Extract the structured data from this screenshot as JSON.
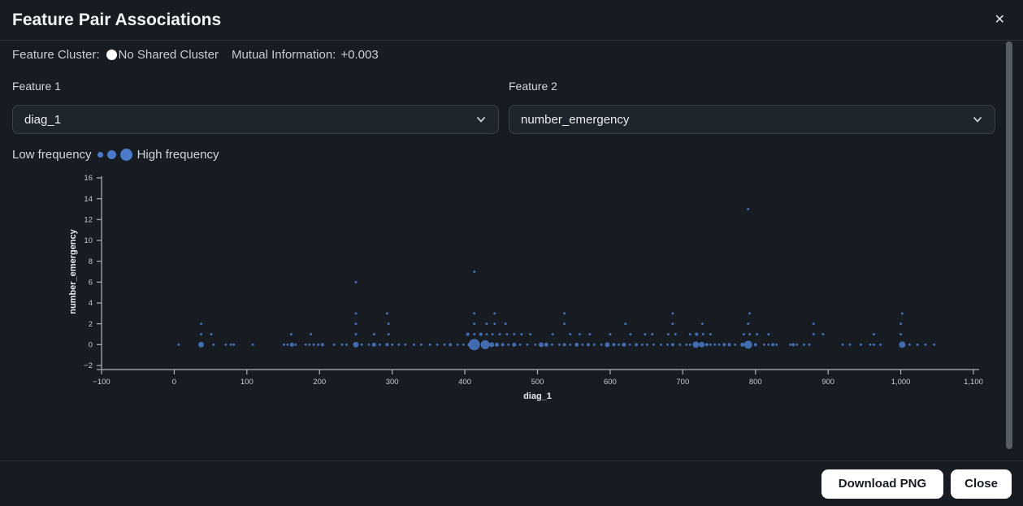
{
  "modal": {
    "title": "Feature Pair Associations",
    "close_icon": "✕"
  },
  "meta": {
    "cluster_label": "Feature Cluster:",
    "cluster_value": "No Shared Cluster",
    "cluster_color": "#ffffff",
    "mi_label": "Mutual Information:",
    "mi_value": "+0.003"
  },
  "features": {
    "feature1_label": "Feature 1",
    "feature1_value": "diag_1",
    "feature2_label": "Feature 2",
    "feature2_value": "number_emergency"
  },
  "legend": {
    "low_label": "Low frequency",
    "high_label": "High frequency",
    "dot_color": "#4a7ac8"
  },
  "footer": {
    "download_label": "Download PNG",
    "close_label": "Close"
  },
  "colors": {
    "background": "#171c22",
    "accent_blue": "#4a7ac8",
    "axis": "#aeb4bb",
    "tick_text": "#c6cbd2"
  },
  "chart_data": {
    "type": "scatter",
    "title": "",
    "xlabel": "diag_1",
    "ylabel": "number_emergency",
    "xlim": [
      -100,
      1100
    ],
    "ylim": [
      -2,
      16
    ],
    "xticks": [
      -100,
      0,
      100,
      200,
      300,
      400,
      500,
      600,
      700,
      800,
      900,
      1000,
      1100
    ],
    "yticks": [
      -2,
      0,
      2,
      4,
      6,
      8,
      10,
      12,
      14,
      16
    ],
    "grid": false,
    "legend_position": "none",
    "point_color": "#4a7ac8",
    "size_meaning": "frequency",
    "points": [
      [
        6,
        0,
        1.5
      ],
      [
        37,
        0,
        3.5
      ],
      [
        54,
        0,
        1.5
      ],
      [
        71,
        0,
        1.5
      ],
      [
        78,
        0,
        1.5
      ],
      [
        82,
        0,
        1.5
      ],
      [
        108,
        0,
        1.5
      ],
      [
        151,
        0,
        1.5
      ],
      [
        156,
        0,
        1.5
      ],
      [
        162,
        0,
        2.5
      ],
      [
        167,
        0,
        1.5
      ],
      [
        181,
        0,
        1.5
      ],
      [
        186,
        0,
        1.5
      ],
      [
        192,
        0,
        1.5
      ],
      [
        198,
        0,
        1.5
      ],
      [
        204,
        0,
        2
      ],
      [
        220,
        0,
        1.5
      ],
      [
        231,
        0,
        1.5
      ],
      [
        237,
        0,
        1.5
      ],
      [
        250,
        0,
        3.5
      ],
      [
        258,
        0,
        1.5
      ],
      [
        268,
        0,
        1.5
      ],
      [
        275,
        0,
        2.5
      ],
      [
        283,
        0,
        1.5
      ],
      [
        293,
        0,
        2
      ],
      [
        300,
        0,
        1.5
      ],
      [
        309,
        0,
        1.5
      ],
      [
        318,
        0,
        1.5
      ],
      [
        330,
        0,
        1.5
      ],
      [
        340,
        0,
        1.5
      ],
      [
        352,
        0,
        1.5
      ],
      [
        362,
        0,
        1.5
      ],
      [
        372,
        0,
        1.5
      ],
      [
        380,
        0,
        2
      ],
      [
        390,
        0,
        1.5
      ],
      [
        398,
        0,
        1.5
      ],
      [
        406,
        0,
        2
      ],
      [
        413,
        0,
        7
      ],
      [
        428,
        0,
        5.5
      ],
      [
        437,
        0,
        3
      ],
      [
        444,
        0,
        2.5
      ],
      [
        452,
        0,
        2
      ],
      [
        460,
        0,
        1.5
      ],
      [
        468,
        0,
        2.5
      ],
      [
        476,
        0,
        1.5
      ],
      [
        486,
        0,
        1.5
      ],
      [
        497,
        0,
        1.5
      ],
      [
        505,
        0,
        3
      ],
      [
        512,
        0,
        2.5
      ],
      [
        520,
        0,
        1.5
      ],
      [
        530,
        0,
        1.5
      ],
      [
        537,
        0,
        2
      ],
      [
        545,
        0,
        1.5
      ],
      [
        554,
        0,
        2.5
      ],
      [
        562,
        0,
        1.5
      ],
      [
        570,
        0,
        2
      ],
      [
        578,
        0,
        1.5
      ],
      [
        588,
        0,
        1.5
      ],
      [
        596,
        0,
        3
      ],
      [
        605,
        0,
        2
      ],
      [
        612,
        0,
        1.5
      ],
      [
        619,
        0,
        2.5
      ],
      [
        627,
        0,
        1.5
      ],
      [
        636,
        0,
        2
      ],
      [
        644,
        0,
        1.5
      ],
      [
        651,
        0,
        1.5
      ],
      [
        660,
        0,
        1.5
      ],
      [
        670,
        0,
        1.5
      ],
      [
        679,
        0,
        1.5
      ],
      [
        686,
        0,
        2
      ],
      [
        696,
        0,
        1.5
      ],
      [
        705,
        0,
        1.5
      ],
      [
        710,
        0,
        1.5
      ],
      [
        718,
        0,
        4
      ],
      [
        726,
        0,
        3.5
      ],
      [
        733,
        0,
        2
      ],
      [
        738,
        0,
        1.5
      ],
      [
        744,
        0,
        1.5
      ],
      [
        750,
        0,
        1.5
      ],
      [
        757,
        0,
        2
      ],
      [
        764,
        0,
        2
      ],
      [
        772,
        0,
        1.5
      ],
      [
        782,
        0,
        2.5
      ],
      [
        790,
        0,
        5
      ],
      [
        800,
        0,
        2
      ],
      [
        812,
        0,
        1.5
      ],
      [
        818,
        0,
        1.5
      ],
      [
        824,
        0,
        2
      ],
      [
        829,
        0,
        1.5
      ],
      [
        848,
        0,
        1.5
      ],
      [
        852,
        0,
        2
      ],
      [
        857,
        0,
        1.5
      ],
      [
        867,
        0,
        1.5
      ],
      [
        874,
        0,
        1.5
      ],
      [
        920,
        0,
        1.5
      ],
      [
        930,
        0,
        1.5
      ],
      [
        945,
        0,
        1.5
      ],
      [
        958,
        0,
        1.5
      ],
      [
        963,
        0,
        1.5
      ],
      [
        972,
        0,
        1.5
      ],
      [
        1002,
        0,
        4
      ],
      [
        1012,
        0,
        1.5
      ],
      [
        1023,
        0,
        1.5
      ],
      [
        1034,
        0,
        1.5
      ],
      [
        1046,
        0,
        1.5
      ],
      [
        37,
        1,
        1.5
      ],
      [
        51,
        1,
        1.5
      ],
      [
        161,
        1,
        1.5
      ],
      [
        188,
        1,
        1.5
      ],
      [
        250,
        1,
        1.5
      ],
      [
        275,
        1,
        1.5
      ],
      [
        295,
        1,
        1.5
      ],
      [
        404,
        1,
        2
      ],
      [
        413,
        1,
        1.5
      ],
      [
        422,
        1,
        2
      ],
      [
        430,
        1,
        1.5
      ],
      [
        438,
        1,
        1.5
      ],
      [
        448,
        1,
        1.5
      ],
      [
        458,
        1,
        1.5
      ],
      [
        468,
        1,
        1.5
      ],
      [
        478,
        1,
        1.5
      ],
      [
        490,
        1,
        1.5
      ],
      [
        521,
        1,
        1.5
      ],
      [
        545,
        1,
        1.5
      ],
      [
        558,
        1,
        1.5
      ],
      [
        572,
        1,
        1.5
      ],
      [
        600,
        1,
        1.5
      ],
      [
        628,
        1,
        1.5
      ],
      [
        648,
        1,
        1.5
      ],
      [
        658,
        1,
        1.5
      ],
      [
        680,
        1,
        1.5
      ],
      [
        690,
        1,
        1.5
      ],
      [
        710,
        1,
        1.5
      ],
      [
        719,
        1,
        2
      ],
      [
        728,
        1,
        1.5
      ],
      [
        738,
        1,
        1.5
      ],
      [
        784,
        1,
        1.5
      ],
      [
        792,
        1,
        1.5
      ],
      [
        802,
        1,
        1.5
      ],
      [
        818,
        1,
        1.5
      ],
      [
        880,
        1,
        1.5
      ],
      [
        893,
        1,
        1.5
      ],
      [
        963,
        1,
        1.5
      ],
      [
        1000,
        1,
        1.5
      ],
      [
        37,
        2,
        1.5
      ],
      [
        250,
        2,
        1.5
      ],
      [
        295,
        2,
        1.5
      ],
      [
        413,
        2,
        1.5
      ],
      [
        430,
        2,
        1.5
      ],
      [
        441,
        2,
        1.5
      ],
      [
        456,
        2,
        1.5
      ],
      [
        537,
        2,
        1.5
      ],
      [
        621,
        2,
        1.5
      ],
      [
        686,
        2,
        1.5
      ],
      [
        727,
        2,
        1.5
      ],
      [
        790,
        2,
        1.5
      ],
      [
        880,
        2,
        1.5
      ],
      [
        1000,
        2,
        1.5
      ],
      [
        250,
        3,
        1.5
      ],
      [
        293,
        3,
        1.5
      ],
      [
        413,
        3,
        1.5
      ],
      [
        441,
        3,
        1.5
      ],
      [
        537,
        3,
        1.5
      ],
      [
        686,
        3,
        1.5
      ],
      [
        792,
        3,
        1.5
      ],
      [
        1002,
        3,
        1.5
      ],
      [
        250,
        6,
        1.5
      ],
      [
        413,
        7,
        1.5
      ],
      [
        790,
        13,
        1.5
      ]
    ]
  }
}
